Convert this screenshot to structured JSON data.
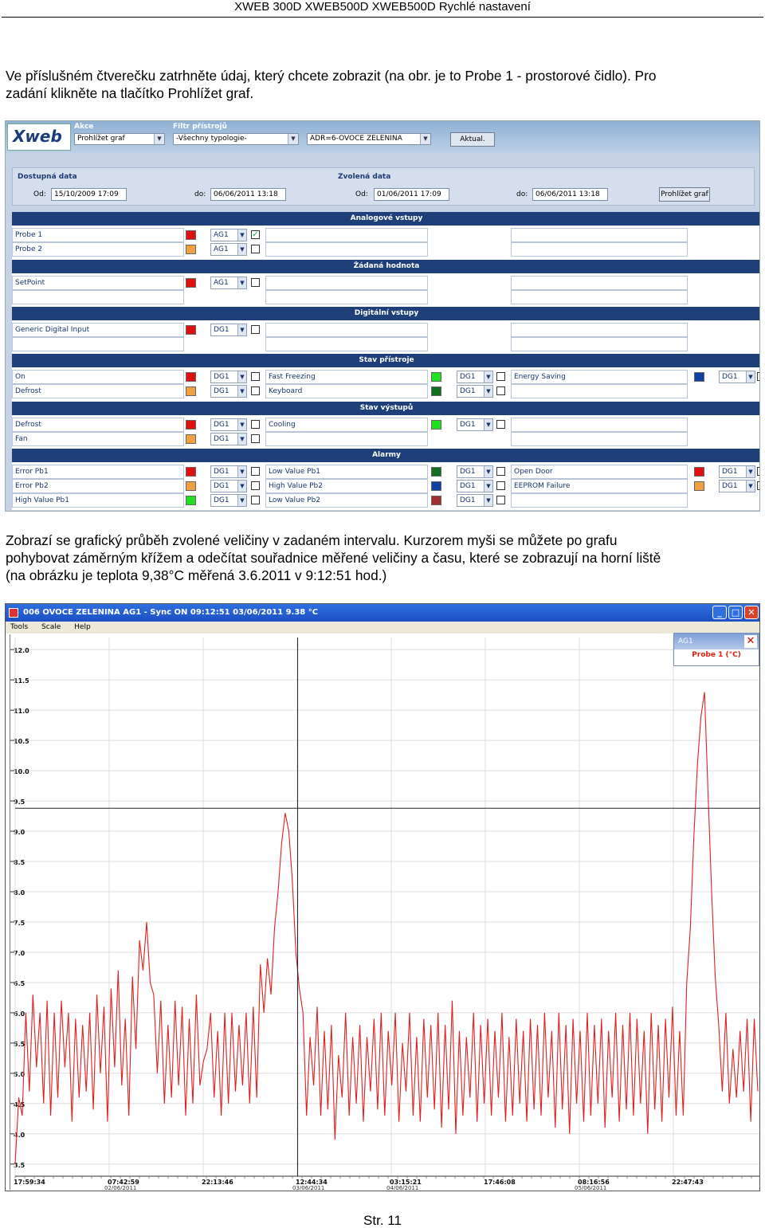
{
  "page": {
    "header": "XWEB 300D  XWEB500D  XWEB500D  Rychlé nastavení",
    "para1_line1": "Ve příslušném čtverečku zatrhněte údaj, který chcete zobrazit (na obr.  je to Probe 1 - prostorové čidlo). Pro",
    "para1_line2": "zadání klikněte na tlačítko Prohlížet graf.",
    "para2_line1": "Zobrazí se grafický průběh zvolené veličiny v zadaném intervalu. Kurzorem myši se můžete po grafu",
    "para2_line2": "pohybovat záměrným křížem a odečítat souřadnice měřené veličiny a času, které se zobrazují na horní liště",
    "para2_line3": "(na obrázku je teplota 9,38°C měřená 3.6.2011 v 9:12:51 hod.)",
    "page_number": "Str. 11"
  },
  "app1": {
    "logo": "Xweb",
    "akce_label": "Akce",
    "akce_value": "Prohlížet graf",
    "filtr_label": "Filtr přístrojů",
    "filtr_value": "-Všechny typologie-",
    "device_value": "ADR=6-OVOCE ZELENINA",
    "aktual_button": "Aktual.",
    "dostupna_label": "Dostupná data",
    "zvolena_label": "Zvolená data",
    "od_label": "Od:",
    "do_label": "do:",
    "dost_od": "15/10/2009 17:09",
    "dost_do": "06/06/2011 13:18",
    "zvol_od": "01/06/2011 17:09",
    "zvol_do": "06/06/2011 13:18",
    "prohlizet_button": "Prohlížet graf",
    "sections": {
      "analog": "Analogové vstupy",
      "setpoint": "Žádaná hodnota",
      "digital": "Digitální vstupy",
      "device": "Stav přístroje",
      "outputs": "Stav výstupů",
      "alarms": "Alarmy"
    },
    "rows": {
      "probe1": "Probe 1",
      "probe2": "Probe 2",
      "setpoint": "SetPoint",
      "generic_di": "Generic Digital Input",
      "on": "On",
      "defrost": "Defrost",
      "fast_freezing": "Fast Freezing",
      "keyboard": "Keyboard",
      "energy_saving": "Energy Saving",
      "out_defrost": "Defrost",
      "fan": "Fan",
      "cooling": "Cooling",
      "err_pb1": "Error Pb1",
      "err_pb2": "Error Pb2",
      "high_pb1": "High Value Pb1",
      "low_pb1": "Low Value Pb1",
      "high_pb2": "High Value Pb2",
      "low_pb2": "Low Value Pb2",
      "open_door": "Open Door",
      "eeprom": "EEPROM Failure"
    },
    "ag1": "AG1",
    "dg1": "DG1",
    "checkmark": "✓",
    "arrow": "▼",
    "colors": {
      "red": "#e01010",
      "orange": "#f0a040",
      "green": "#20e020",
      "darkgreen": "#107020",
      "navy": "#1040a0",
      "brown": "#a03030"
    }
  },
  "app2": {
    "title": "006 OVOCE ZELENINA AG1 - Sync ON   09:12:51 03/06/2011  9.38 °C",
    "menu": [
      "Tools",
      "Scale",
      "Help"
    ],
    "legend_title": "AG1",
    "legend_close": "✕",
    "win_min": "_",
    "win_max": "□",
    "win_close": "✕",
    "line_color": "#e02020"
  },
  "chart_data": {
    "type": "line",
    "title": "",
    "xlabel": "",
    "ylabel": "",
    "ylim": [
      3.3,
      12.2
    ],
    "yticks": [
      "12.0",
      "11.5",
      "11.0",
      "10.5",
      "10.0",
      "9.5",
      "9.0",
      "8.5",
      "8.0",
      "7.5",
      "7.0",
      "6.5",
      "6.0",
      "5.5",
      "5.0",
      "4.5",
      "4.0",
      "3.5"
    ],
    "xticks": [
      {
        "time": "17:59:34",
        "date": ""
      },
      {
        "time": "07:42:59",
        "date": "02/06/2011"
      },
      {
        "time": "22:13:46",
        "date": ""
      },
      {
        "time": "12:44:34",
        "date": "03/06/2011"
      },
      {
        "time": "03:15:21",
        "date": "04/06/2011"
      },
      {
        "time": "17:46:08",
        "date": ""
      },
      {
        "time": "08:16:56",
        "date": "05/06/2011"
      },
      {
        "time": "22:47:43",
        "date": ""
      }
    ],
    "cursor": {
      "x_index": 79.5,
      "y": 9.38
    },
    "series": [
      {
        "name": "Probe 1 (°C)",
        "values": [
          3.5,
          4.6,
          4.3,
          6.0,
          4.7,
          6.3,
          5.1,
          6.0,
          4.5,
          6.2,
          4.3,
          6.0,
          4.6,
          6.2,
          5.1,
          6.0,
          4.2,
          5.9,
          4.6,
          5.8,
          4.7,
          6.0,
          4.4,
          6.3,
          5.0,
          6.1,
          4.2,
          6.4,
          5.1,
          6.7,
          4.8,
          5.9,
          4.3,
          6.6,
          5.4,
          7.2,
          6.7,
          7.5,
          6.5,
          6.3,
          5.0,
          6.2,
          4.5,
          5.8,
          4.6,
          6.2,
          4.8,
          6.1,
          4.3,
          5.9,
          4.5,
          6.3,
          4.8,
          5.2,
          5.4,
          6.0,
          4.6,
          5.7,
          4.3,
          6.0,
          4.5,
          6.0,
          4.7,
          5.8,
          4.8,
          6.0,
          4.5,
          6.1,
          4.6,
          6.8,
          6.0,
          6.9,
          6.3,
          7.4,
          8.0,
          8.8,
          9.3,
          9.0,
          8.2,
          7.0,
          6.4,
          6.0,
          4.3,
          5.6,
          4.8,
          6.1,
          4.3,
          5.7,
          4.4,
          5.8,
          3.9,
          5.3,
          4.6,
          6.0,
          4.3,
          5.6,
          4.5,
          5.8,
          4.2,
          5.6,
          4.7,
          5.9,
          4.4,
          6.0,
          4.3,
          5.7,
          4.8,
          6.0,
          4.2,
          5.5,
          4.7,
          6.0,
          4.3,
          5.6,
          4.2,
          5.9,
          4.6,
          5.8,
          4.4,
          6.0,
          4.1,
          5.8,
          4.4,
          6.2,
          4.0,
          5.7,
          4.3,
          5.6,
          4.6,
          6.0,
          4.2,
          5.8,
          4.5,
          5.9,
          4.3,
          5.7,
          4.6,
          6.0,
          4.2,
          5.6,
          4.3,
          5.9,
          4.5,
          5.7,
          4.2,
          5.9,
          4.4,
          5.8,
          4.3,
          6.0,
          4.6,
          5.7,
          4.1,
          6.0,
          4.4,
          5.8,
          4.0,
          5.9,
          4.5,
          5.7,
          4.2,
          6.0,
          4.3,
          5.8,
          4.5,
          5.9,
          4.1,
          5.7,
          4.6,
          6.0,
          4.2,
          5.8,
          4.4,
          6.0,
          4.3,
          5.9,
          4.5,
          5.7,
          4.0,
          6.0,
          4.4,
          5.8,
          4.2,
          5.9,
          4.6,
          6.1,
          4.3,
          5.7,
          4.3,
          6.5,
          7.4,
          8.9,
          10.1,
          10.9,
          11.3,
          9.6,
          8.0,
          6.6,
          5.8,
          4.7,
          6.0,
          4.5,
          5.4,
          4.6,
          5.7,
          4.7,
          5.9,
          4.2,
          5.9,
          4.7
        ],
        "color": "#e02020"
      }
    ]
  }
}
